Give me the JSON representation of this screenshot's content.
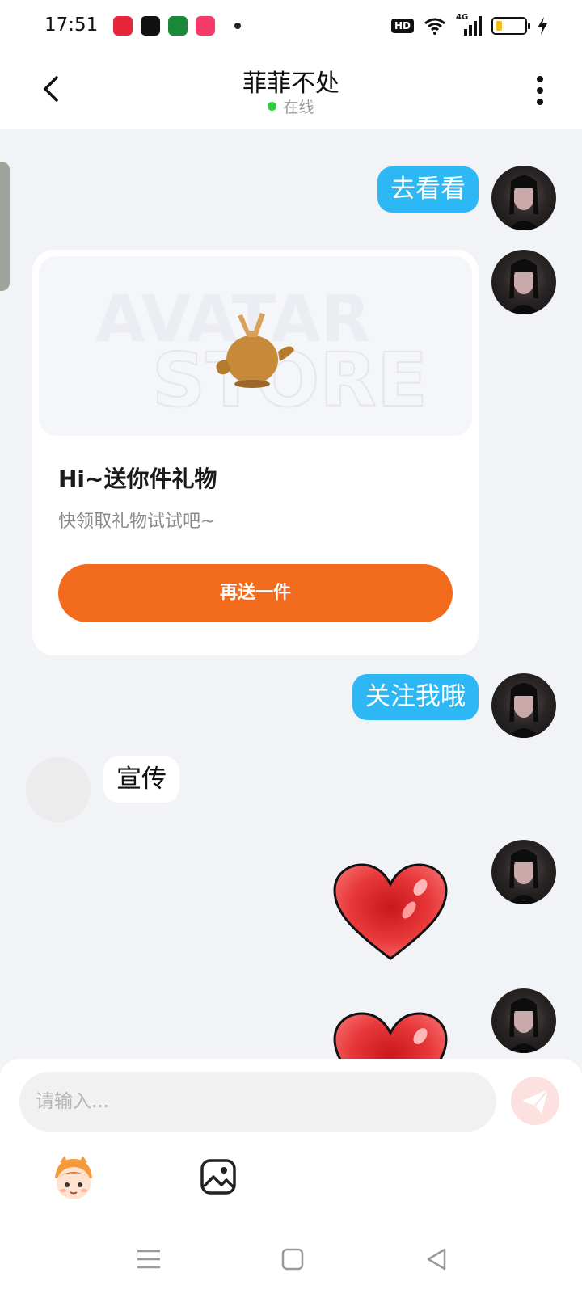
{
  "status_bar": {
    "time": "17:51",
    "hd": "HD",
    "network": "4G"
  },
  "header": {
    "title": "菲菲不处",
    "status": "在线"
  },
  "messages": [
    {
      "side": "right",
      "type": "text",
      "text": "去看看"
    },
    {
      "side": "right",
      "type": "gift_card",
      "banner_text_line1": "AVATAR",
      "banner_text_line2": "STORE",
      "title": "Hi~送你件礼物",
      "subtitle": "快领取礼物试试吧~",
      "button_label": "再送一件"
    },
    {
      "side": "right",
      "type": "text",
      "text": "关注我哦"
    },
    {
      "side": "left",
      "type": "text",
      "text": "宣传"
    },
    {
      "side": "right",
      "type": "sticker",
      "sticker": "red-heart"
    },
    {
      "side": "right",
      "type": "sticker",
      "sticker": "red-heart"
    }
  ],
  "input": {
    "placeholder": "请输入..."
  },
  "colors": {
    "bubble_blue": "#2db7f5",
    "gift_button": "#f26b1d",
    "online_dot": "#2ecc40"
  }
}
